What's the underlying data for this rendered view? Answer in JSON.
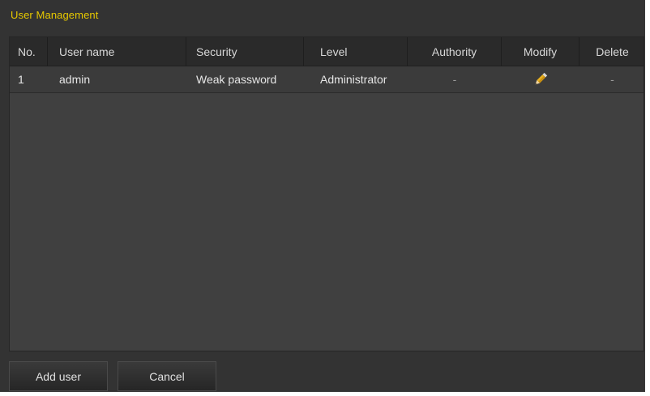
{
  "window": {
    "title": "User Management"
  },
  "table": {
    "columns": [
      "No.",
      "User name",
      "Security",
      "Level",
      "Authority",
      "Modify",
      "Delete"
    ],
    "rows": [
      {
        "no": "1",
        "user_name": "admin",
        "security": "Weak password",
        "level": "Administrator",
        "authority": "-",
        "modify_icon": "pencil-icon",
        "delete": "-"
      }
    ]
  },
  "buttons": {
    "add_user": "Add user",
    "cancel": "Cancel"
  },
  "colors": {
    "title": "#e6c800",
    "background": "#333333",
    "panel": "#404040",
    "header": "#2a2a2a",
    "pencil": "#e8b020"
  }
}
